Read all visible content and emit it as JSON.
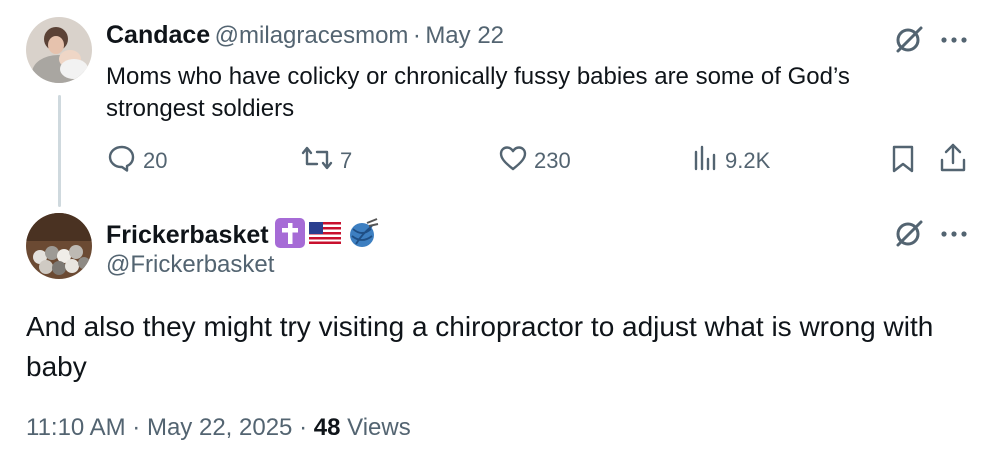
{
  "original_tweet": {
    "author_name": "Candace",
    "author_handle": "@milagracesmom",
    "separator": "·",
    "date": "May 22",
    "text": "Moms who have colicky or chronically fussy babies are some of God’s strongest soldiers",
    "actions": {
      "replies": "20",
      "reposts": "7",
      "likes": "230",
      "views": "9.2K"
    }
  },
  "reply_tweet": {
    "author_name": "Frickerbasket",
    "author_handle": "@Frickerbasket",
    "text": "And also they might try visiting a chiropractor to adjust what is wrong with baby",
    "time": "11:10 AM",
    "separator": "·",
    "date": "May 22, 2025",
    "separator2": "·",
    "views_count": "48",
    "views_label": "Views"
  },
  "colors": {
    "muted": "#536471",
    "text": "#0f1419",
    "thread_line": "#cfd9de",
    "cross_badge": "#a66bd6"
  },
  "icons": [
    "grok-icon",
    "more-icon",
    "reply-icon",
    "repost-icon",
    "like-icon",
    "views-icon",
    "bookmark-icon",
    "share-icon",
    "cross-emoji-icon",
    "us-flag-icon",
    "yarn-emoji-icon"
  ]
}
